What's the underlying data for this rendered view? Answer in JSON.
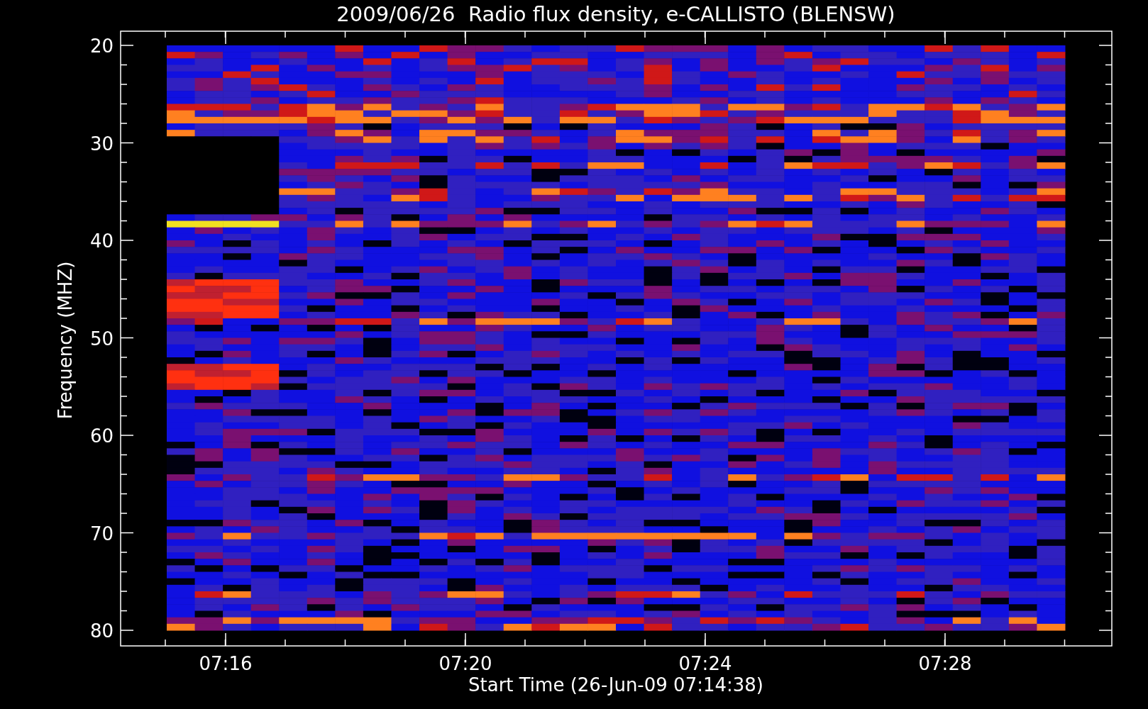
{
  "title": "2009/06/26  Radio flux density, e-CALLISTO (BLENSW)",
  "y_axis": {
    "label": "Frequency (MHZ)",
    "ticks": [
      "20",
      "30",
      "40",
      "50",
      "60",
      "70",
      "80"
    ]
  },
  "x_axis": {
    "label": "Start Time (26-Jun-09 07:14:38)",
    "ticks": [
      "07:16",
      "07:20",
      "07:24",
      "07:28"
    ]
  }
}
